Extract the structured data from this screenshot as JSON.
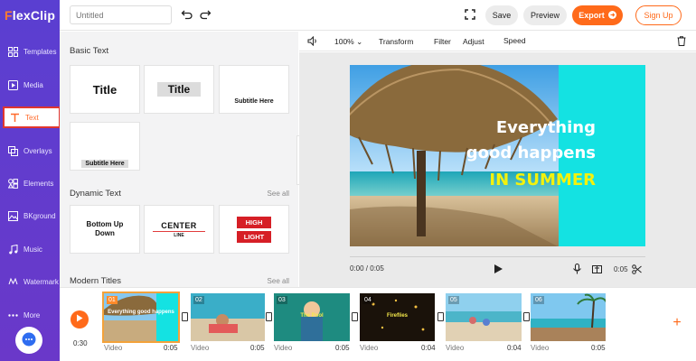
{
  "app": {
    "logo": "FlexClip",
    "logo_first": "F",
    "logo_rest": "lexClip",
    "accent_color": "#ff6a1a",
    "sidebar_color": "#5a3fd1"
  },
  "sidebar": {
    "items": [
      {
        "label": "Templates",
        "icon": "templates-icon"
      },
      {
        "label": "Media",
        "icon": "media-icon"
      },
      {
        "label": "Text",
        "icon": "text-icon",
        "active": true
      },
      {
        "label": "Overlays",
        "icon": "overlays-icon"
      },
      {
        "label": "Elements",
        "icon": "elements-icon"
      },
      {
        "label": "BKground",
        "icon": "background-icon"
      },
      {
        "label": "Music",
        "icon": "music-icon"
      },
      {
        "label": "Watermark",
        "icon": "watermark-icon"
      },
      {
        "label": "More",
        "icon": "more-icon"
      }
    ]
  },
  "topbar": {
    "title_placeholder": "Untitled",
    "save": "Save",
    "preview": "Preview",
    "export": "Export",
    "signup": "Sign Up"
  },
  "panel": {
    "basic_title": "Basic Text",
    "basic_cards": [
      "Title",
      "Title",
      "Subtitle Here",
      "Subtitle Here"
    ],
    "dynamic_title": "Dynamic Text",
    "dynamic_see_all": "See all",
    "dynamic_cards": {
      "bud": "Bottom Up Down",
      "center_big": "CENTER",
      "center_small": "LINE",
      "hl_1": "HIGH",
      "hl_2": "LIGHT"
    },
    "modern_title": "Modern Titles",
    "modern_see_all": "See all"
  },
  "editor": {
    "zoom": "100%",
    "tools": [
      "Transform",
      "Filter",
      "Adjust",
      "Speed"
    ],
    "canvas_text": [
      "Everything",
      "good happens",
      "IN SUMMER"
    ],
    "time_current": "0:00 / 0:05",
    "duration": "0:05"
  },
  "timeline": {
    "total": "0:30",
    "clips": [
      {
        "num": "01",
        "label": "Video",
        "dur": "0:05",
        "text": "Everything good happens"
      },
      {
        "num": "02",
        "label": "Video",
        "dur": "0:05",
        "text": ""
      },
      {
        "num": "03",
        "label": "Video",
        "dur": "0:05",
        "text": "The Pool"
      },
      {
        "num": "04",
        "label": "Video",
        "dur": "0:04",
        "text": "Fireflies"
      },
      {
        "num": "05",
        "label": "Video",
        "dur": "0:04",
        "text": ""
      },
      {
        "num": "06",
        "label": "Video",
        "dur": "0:05",
        "text": ""
      }
    ]
  }
}
